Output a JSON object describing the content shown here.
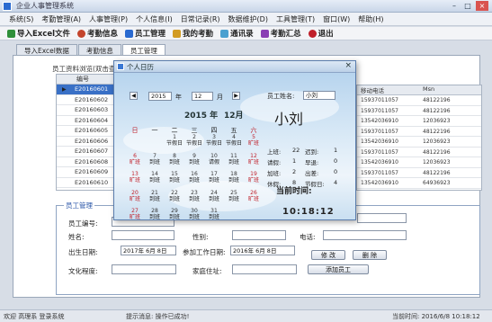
{
  "window": {
    "title": "企业人事管理系统",
    "min": "–",
    "max": "□",
    "close": "×"
  },
  "menu": [
    "系统(S)",
    "考勤管理(A)",
    "人事管理(P)",
    "个人信息(I)",
    "日常记录(R)",
    "数据维护(D)",
    "工具管理(T)",
    "窗口(W)",
    "帮助(H)"
  ],
  "toolbar": [
    {
      "label": "导入Excel文件",
      "icon": "excel-icon",
      "color": "#2f8f3a"
    },
    {
      "label": "考勤信息",
      "icon": "clock-icon",
      "color": "#c4452c"
    },
    {
      "label": "员工管理",
      "icon": "user-icon",
      "color": "#2a6ad0"
    },
    {
      "label": "我的考勤",
      "icon": "calendar-icon",
      "color": "#d29b22"
    },
    {
      "label": "通讯录",
      "icon": "phone-icon",
      "color": "#4aa0d0"
    },
    {
      "label": "考勤汇总",
      "icon": "chart-icon",
      "color": "#8a3fb4"
    },
    {
      "label": "退出",
      "icon": "exit-icon",
      "color": "#c0202a"
    }
  ],
  "tabs": [
    "导入Excel数据",
    "考勤信息",
    "员工管理"
  ],
  "active_tab": 2,
  "grid_caption": "员工资料浏览(双击查看)",
  "grid_left": {
    "header": "编号",
    "rows": [
      "E20160601",
      "E20160602",
      "E20160603",
      "E20160604",
      "E20160605",
      "E20160606",
      "E20160607",
      "E20160608",
      "E20160609",
      "E20160610"
    ]
  },
  "grid_right": {
    "headers": [
      "移动电话",
      "Msn"
    ],
    "rows": [
      [
        "15937011057",
        "48122196"
      ],
      [
        "15937011057",
        "48122196"
      ],
      [
        "13542036910",
        "12036923"
      ],
      [
        "15937011057",
        "48122196"
      ],
      [
        "13542036910",
        "12036923"
      ],
      [
        "15937011057",
        "48122196"
      ],
      [
        "13542036910",
        "12036923"
      ],
      [
        "15937011057",
        "48122196"
      ],
      [
        "13542036910",
        "64936923"
      ]
    ]
  },
  "form": {
    "legend": "员工管理",
    "labels": {
      "no": "员工编号:",
      "name": "姓名:",
      "sex": "性别:",
      "phone": "电话:",
      "birth": "出生日期:",
      "join": "参加工作日期:",
      "edu": "文化程度:",
      "home": "家庭住址:"
    },
    "birth_value": "2017年 6月 8日",
    "join_value": "2016年 6月 8日",
    "buttons": {
      "modify": "修 改",
      "delete": "删 除",
      "add": "添加员工"
    }
  },
  "dialog": {
    "title": "个人日历",
    "close": "×",
    "year": "2015",
    "year_unit": "年",
    "month": "12",
    "month_unit": "月",
    "name_label": "员工姓名:",
    "name_value": "小刘",
    "cal_year_title": "2015 年",
    "cal_month_title": "12月",
    "weekdays": [
      "日",
      "一",
      "二",
      "三",
      "四",
      "五",
      "六"
    ],
    "days": [
      {
        "d": "",
        "s": ""
      },
      {
        "d": "",
        "s": ""
      },
      {
        "d": "1",
        "s": "节假日"
      },
      {
        "d": "2",
        "s": "节假日"
      },
      {
        "d": "3",
        "s": "节假日"
      },
      {
        "d": "4",
        "s": "节假日"
      },
      {
        "d": "5",
        "s": "旷班",
        "r": true
      },
      {
        "d": "6",
        "s": "旷班",
        "r": true
      },
      {
        "d": "7",
        "s": "到班"
      },
      {
        "d": "8",
        "s": "到班"
      },
      {
        "d": "9",
        "s": "到班"
      },
      {
        "d": "10",
        "s": "请假"
      },
      {
        "d": "11",
        "s": "到班"
      },
      {
        "d": "12",
        "s": "旷班",
        "r": true
      },
      {
        "d": "13",
        "s": "旷班",
        "r": true
      },
      {
        "d": "14",
        "s": "到班"
      },
      {
        "d": "15",
        "s": "到班"
      },
      {
        "d": "16",
        "s": "到班"
      },
      {
        "d": "17",
        "s": "到班"
      },
      {
        "d": "18",
        "s": "到班"
      },
      {
        "d": "19",
        "s": "旷班",
        "r": true
      },
      {
        "d": "20",
        "s": "旷班",
        "r": true
      },
      {
        "d": "21",
        "s": "到班"
      },
      {
        "d": "22",
        "s": "到班"
      },
      {
        "d": "23",
        "s": "到班"
      },
      {
        "d": "24",
        "s": "到班"
      },
      {
        "d": "25",
        "s": "到班"
      },
      {
        "d": "26",
        "s": "旷班",
        "r": true
      },
      {
        "d": "27",
        "s": "旷班",
        "r": true
      },
      {
        "d": "28",
        "s": "到班"
      },
      {
        "d": "29",
        "s": "到班"
      },
      {
        "d": "30",
        "s": "到班"
      },
      {
        "d": "31",
        "s": "到班"
      }
    ],
    "stats": [
      {
        "label": "上班:",
        "value": "22",
        "label2": "迟到:",
        "value2": "1"
      },
      {
        "label": "请假:",
        "value": "1",
        "label2": "早退:",
        "value2": "0"
      },
      {
        "label": "加班:",
        "value": "2",
        "label2": "出差:",
        "value2": "0"
      },
      {
        "label": "休假:",
        "value": "8",
        "label2": "节假日:",
        "value2": "4"
      }
    ],
    "now_label": "当前时间:",
    "clock": "10:18:12"
  },
  "statusbar": {
    "welcome": "欢迎 高理系 登录系统",
    "hint": "提示消息: 操作已成功!",
    "time": "当前时间: 2016/6/8 10:18:12"
  }
}
